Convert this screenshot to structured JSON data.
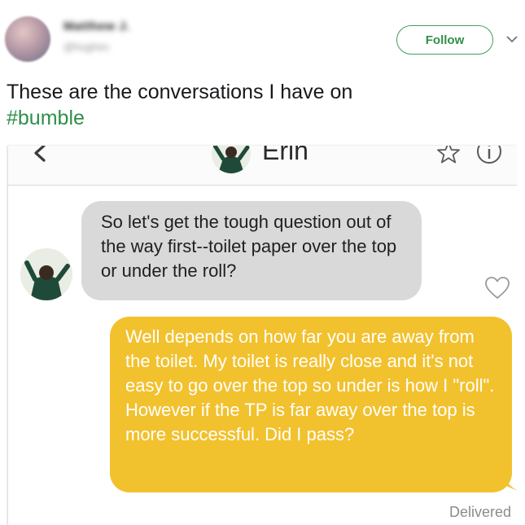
{
  "tweet": {
    "user_name": "Matthew J.",
    "user_handle": "@hughes",
    "follow_label": "Follow",
    "text_line1": "These are the conversations I have on",
    "hashtag": "#bumble"
  },
  "screenshot": {
    "match_name": "Erin",
    "received_message": "So let's get the tough question out of the way first--toilet paper over the top or under the roll?",
    "sent_message": "Well depends on how far you are away from the toilet. My toilet is really close and it's not easy to go over the top so under is how I \"roll\". However if the TP is far away over the top is more successful. Did I pass?",
    "status": "Delivered"
  },
  "colors": {
    "brand_green": "#2e8f49",
    "sent_bubble": "#f2c12e",
    "received_bubble": "#d9d9d9"
  },
  "icons": [
    "chevron-down-icon",
    "back-chevron-icon",
    "star-icon",
    "info-icon",
    "heart-icon"
  ]
}
